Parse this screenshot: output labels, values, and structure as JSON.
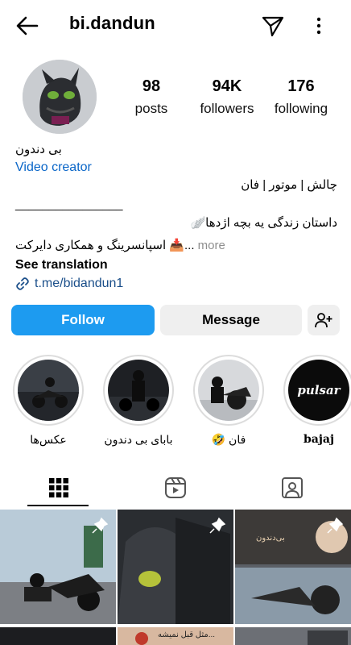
{
  "header": {
    "username": "bi.dandun"
  },
  "stats": {
    "posts_count": "98",
    "posts_label": "posts",
    "followers_count": "94K",
    "followers_label": "followers",
    "following_count": "176",
    "following_label": "following"
  },
  "bio": {
    "name": "بی دندون",
    "category": "Video creator",
    "tags": "چالش | موتور | فان",
    "divider": "________________",
    "story": "داستان زندگی یه بچه اژدها🪽",
    "sponsor": "اسپانسرینگ و همکاری دایرکت 📥...",
    "more": " more",
    "see_translation": "See translation",
    "link": "t.me/bidandun1"
  },
  "actions": {
    "follow": "Follow",
    "message": "Message"
  },
  "highlights": [
    {
      "label": "عکس‌ها"
    },
    {
      "label": "بابای بی دندون"
    },
    {
      "label": "فان 🤣"
    },
    {
      "label": "bajaj",
      "inner_text": "pulsar"
    }
  ],
  "grid": {
    "overlay_2": "مثل قبل نمیشه...",
    "overlay_3": "بی‌دندون"
  },
  "colors": {
    "follow_button": "#1d9bf0",
    "secondary_button": "#efefef",
    "link": "#0a66c8"
  }
}
